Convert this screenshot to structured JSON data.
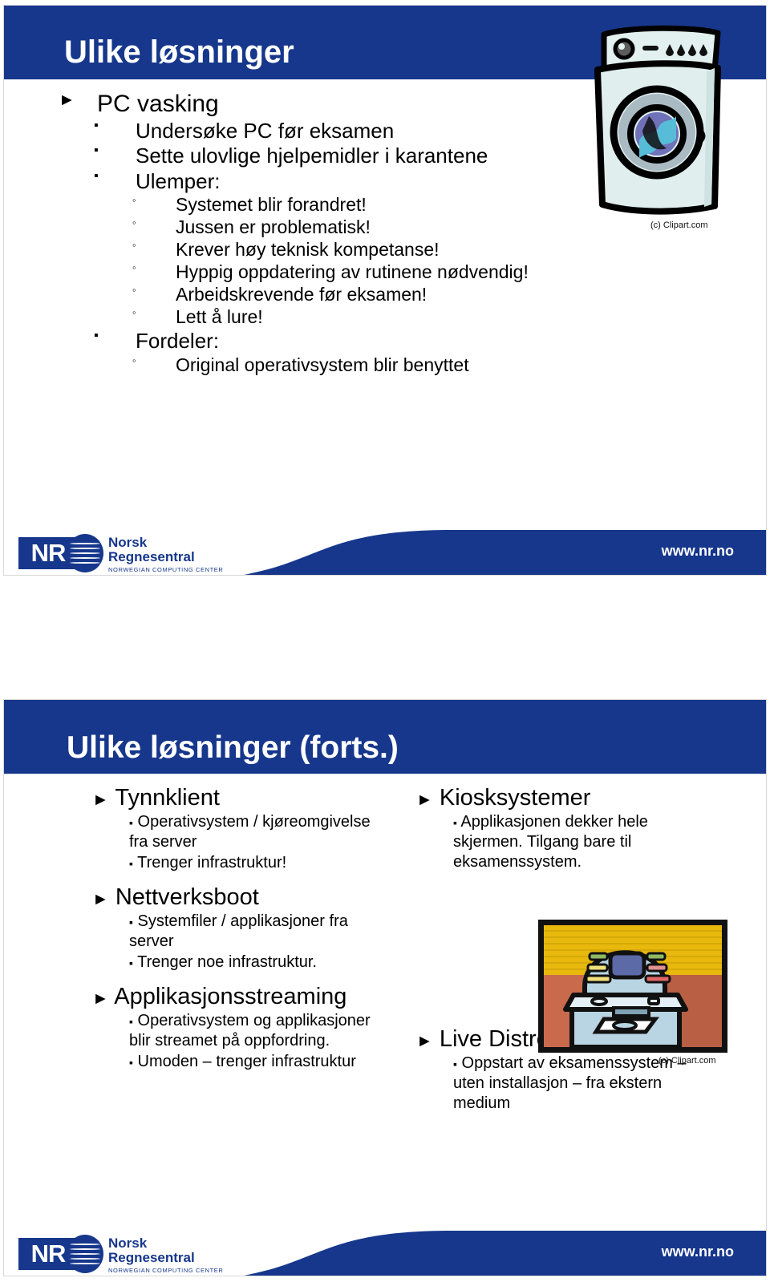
{
  "theme": {
    "brand_blue": "#16378C",
    "page_bg": "#ffffff",
    "text_color": "#000000"
  },
  "slides": [
    {
      "id": "slide-1",
      "title": "Ulike løsninger",
      "bullets": [
        {
          "level": 1,
          "text": "PC vasking"
        },
        {
          "level": 2,
          "text": "Undersøke PC før eksamen"
        },
        {
          "level": 2,
          "text": "Sette ulovlige hjelpemidler i karantene"
        },
        {
          "level": 2,
          "text": "Ulemper:"
        },
        {
          "level": 3,
          "text": "Systemet blir forandret!"
        },
        {
          "level": 3,
          "text": "Jussen er problematisk!"
        },
        {
          "level": 3,
          "text": "Krever høy teknisk kompetanse!"
        },
        {
          "level": 3,
          "text": "Hyppig oppdatering av rutinene nødvendig!"
        },
        {
          "level": 3,
          "text": "Arbeidskrevende før eksamen!"
        },
        {
          "level": 3,
          "text": "Lett å lure!"
        },
        {
          "level": 2,
          "text": "Fordeler:"
        },
        {
          "level": 3,
          "text": "Original operativsystem blir benyttet"
        }
      ],
      "image": {
        "name": "washing-machine-clipart",
        "caption": "(c) Clipart.com"
      },
      "footer": {
        "url": "www.nr.no",
        "logo_mark": "NR",
        "logo_line1": "Norsk",
        "logo_line2": "Regnesentral",
        "logo_sub": "NORWEGIAN COMPUTING CENTER"
      }
    },
    {
      "id": "slide-2",
      "title": "Ulike løsninger (forts.)",
      "left_column": [
        {
          "heading": "Tynnklient",
          "items": [
            "Operativsystem / kjøreomgivelse fra server",
            "Trenger infrastruktur!"
          ]
        },
        {
          "heading": "Nettverksboot",
          "items": [
            "Systemfiler / applikasjoner fra server",
            "Trenger noe infrastruktur."
          ]
        },
        {
          "heading": "Applikasjonsstreaming",
          "items": [
            "Operativsystem og applikasjoner blir streamet på oppfordring.",
            "Umoden – trenger infrastruktur"
          ]
        }
      ],
      "right_column": [
        {
          "heading": "Kiosksystemer",
          "items": [
            "Applikasjonen dekker hele skjermen. Tilgang bare til eksamenssystem."
          ]
        },
        {
          "heading": "Live Distro",
          "items": [
            "Oppstart av eksamenssystem – uten installasjon – fra ekstern medium"
          ]
        }
      ],
      "image": {
        "name": "kiosk-terminal-clipart",
        "caption": "(c) Clipart.com"
      },
      "footer": {
        "url": "www.nr.no",
        "logo_mark": "NR",
        "logo_line1": "Norsk",
        "logo_line2": "Regnesentral",
        "logo_sub": "NORWEGIAN COMPUTING CENTER"
      }
    }
  ],
  "bullet_glyphs": {
    "level1": "►",
    "level2": "▪",
    "level3": "◦"
  }
}
